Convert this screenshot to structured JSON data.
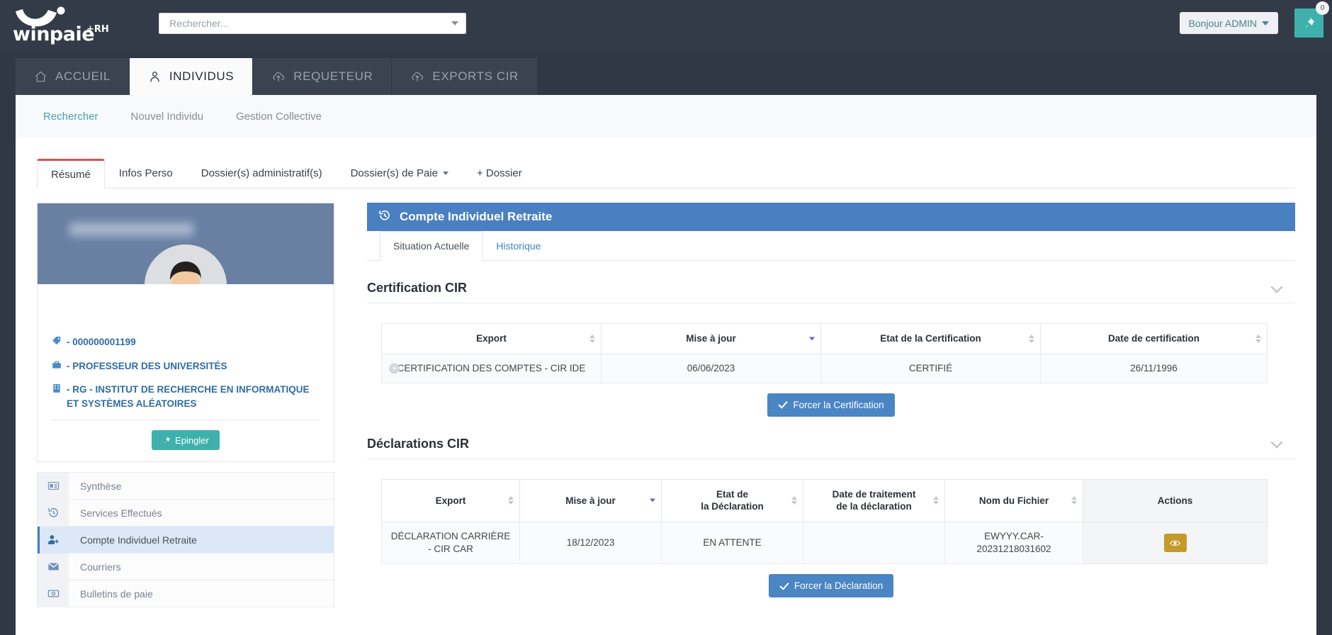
{
  "brand": {
    "name": "winpaie",
    "suffix": "+RH",
    "accent": "#3fb1ac"
  },
  "search": {
    "placeholder": "Rechercher...",
    "value": ""
  },
  "user": {
    "greeting": "Bonjour ADMIN",
    "pin_badge": "0"
  },
  "main_tabs": [
    {
      "label": "ACCUEIL",
      "icon": "home-icon",
      "active": false
    },
    {
      "label": "INDIVIDUS",
      "icon": "person-icon",
      "active": true
    },
    {
      "label": "REQUETEUR",
      "icon": "cloud-upload-icon",
      "active": false
    },
    {
      "label": "EXPORTS CIR",
      "icon": "cloud-upload-icon",
      "active": false
    }
  ],
  "subnav": [
    {
      "label": "Rechercher",
      "active": true
    },
    {
      "label": "Nouvel Individu",
      "active": false
    },
    {
      "label": "Gestion Collective",
      "active": false
    }
  ],
  "section_tabs": [
    {
      "label": "Résumé",
      "active": true,
      "caret": false
    },
    {
      "label": "Infos Perso",
      "active": false,
      "caret": false
    },
    {
      "label": "Dossier(s) administratif(s)",
      "active": false,
      "caret": false
    },
    {
      "label": "Dossier(s) de Paie",
      "active": false,
      "caret": true
    },
    {
      "label": "+ Dossier",
      "active": false,
      "caret": false
    }
  ],
  "profile": {
    "name_redacted": "",
    "matricule": "- 000000001199",
    "job": "- PROFESSEUR DES UNIVERSITÉS",
    "org": "- RG - INSTITUT DE RECHERCHE EN INFORMATIQUE ET SYSTÈMES ALÉATOIRES",
    "pin_label": "Epingler"
  },
  "sidemenu": [
    {
      "label": "Synthèse",
      "icon": "id-card-icon",
      "active": false
    },
    {
      "label": "Services Effectués",
      "icon": "history-icon",
      "active": false
    },
    {
      "label": "Compte Individuel Retraite",
      "icon": "user-plus-icon",
      "active": true
    },
    {
      "label": "Courriers",
      "icon": "envelope-icon",
      "active": false
    },
    {
      "label": "Bulletins de paie",
      "icon": "money-icon",
      "active": false
    }
  ],
  "panel": {
    "title": "Compte Individuel Retraite",
    "icon": "history-icon",
    "tabs": [
      {
        "label": "Situation Actuelle",
        "active": true
      },
      {
        "label": "Historique",
        "active": false
      }
    ]
  },
  "certification": {
    "title": "Certification CIR",
    "columns": [
      {
        "label": "Export",
        "sort": "none"
      },
      {
        "label": "Mise à jour",
        "sort": "desc"
      },
      {
        "label": "Etat de la Certification",
        "sort": "none"
      },
      {
        "label": "Date de certification",
        "sort": "none"
      }
    ],
    "rows": [
      {
        "export": "CERTIFICATION DES COMPTES - CIR IDE",
        "mise_a_jour": "06/06/2023",
        "etat": "CERTIFIÉ",
        "date_certification": "26/11/1996"
      }
    ],
    "action_button": "Forcer la Certification"
  },
  "declarations": {
    "title": "Déclarations CIR",
    "columns": [
      {
        "label": "Export",
        "sort": "none"
      },
      {
        "label": "Mise à jour",
        "sort": "desc"
      },
      {
        "label": "Etat de\nla Déclaration",
        "line1": "Etat de",
        "line2": "la Déclaration",
        "sort": "none"
      },
      {
        "label": "Date de traitement\nde la déclaration",
        "line1": "Date de traitement",
        "line2": "de la déclaration",
        "sort": "none"
      },
      {
        "label": "Nom du Fichier",
        "sort": "none"
      },
      {
        "label": "Actions",
        "sort": "none"
      }
    ],
    "rows": [
      {
        "export": "DÉCLARATION CARRIÈRE - CIR CAR",
        "mise_a_jour": "18/12/2023",
        "etat": "EN ATTENTE",
        "date_traitement": "",
        "nom_fichier": "EWYYY.CAR-20231218031602",
        "action_icon": "eye-icon"
      }
    ],
    "action_button": "Forcer la Déclaration"
  }
}
